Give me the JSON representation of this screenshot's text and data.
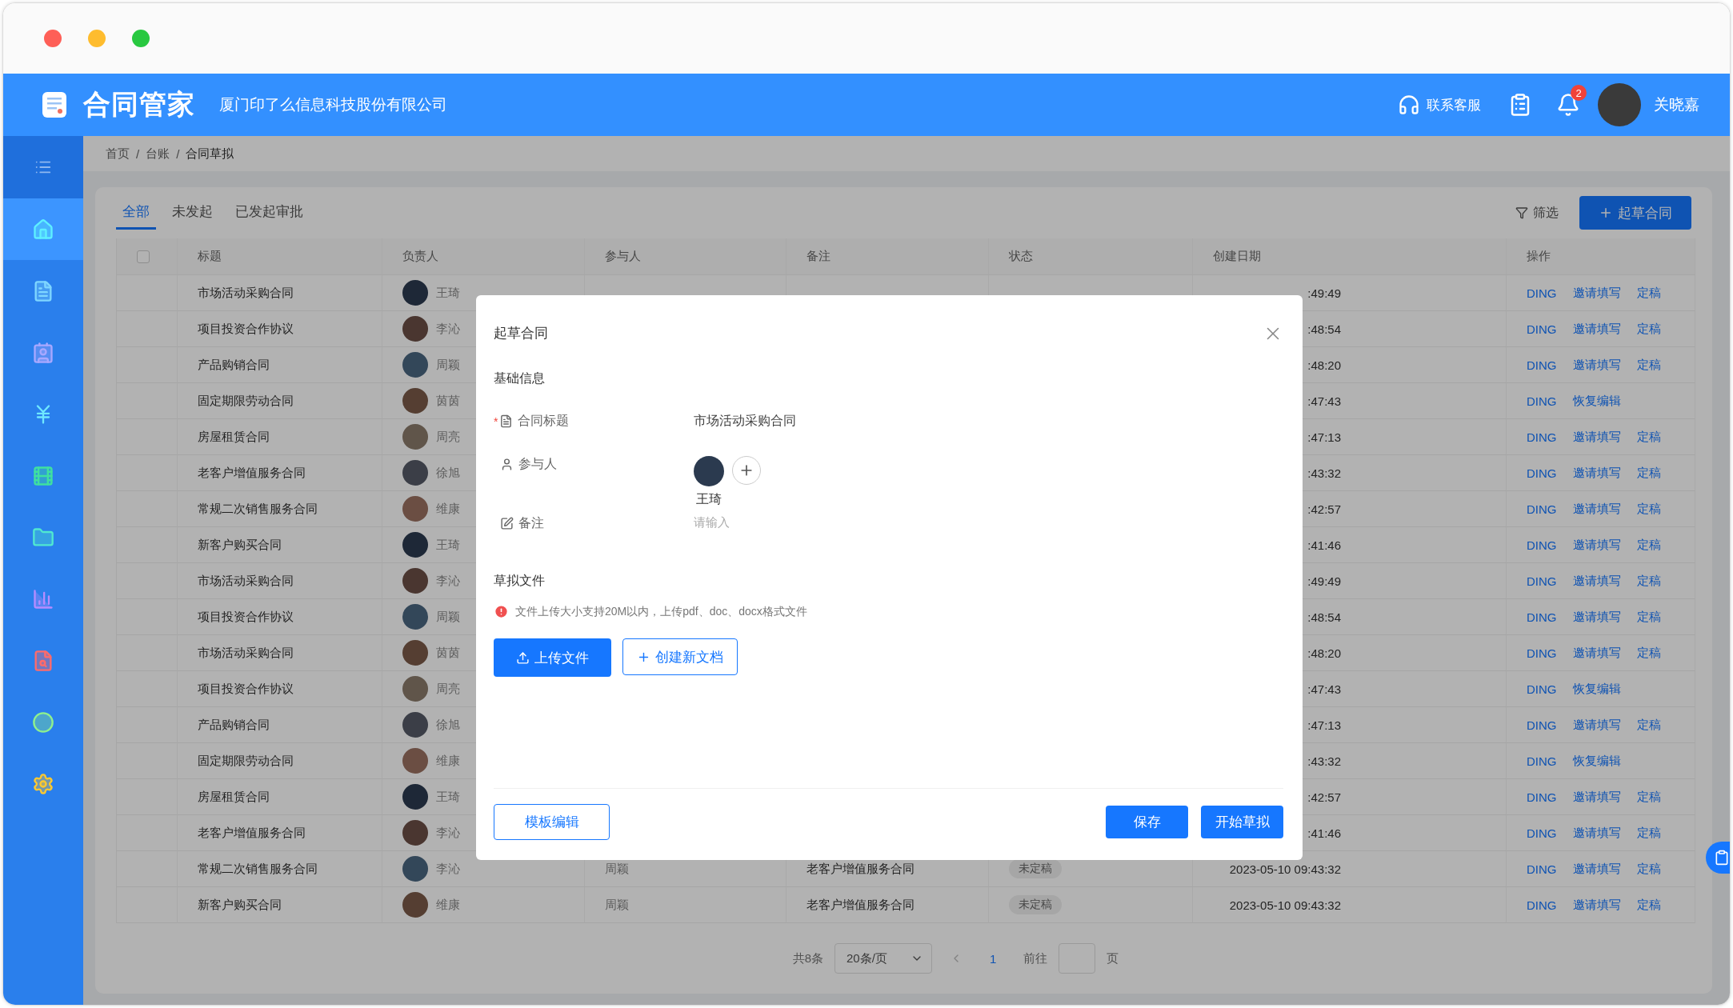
{
  "header": {
    "logo_text": "合同管家",
    "company": "厦门印了么信息科技股份有限公司",
    "support": "联系客服",
    "notification_count": "2",
    "user_name": "关晓嘉"
  },
  "sidebar": {
    "items": [
      {
        "selected": true
      },
      {
        "selected": false
      },
      {
        "selected": false
      },
      {
        "selected": false
      },
      {
        "selected": false
      },
      {
        "selected": false
      },
      {
        "selected": false
      },
      {
        "selected": false
      },
      {
        "selected": false
      },
      {
        "selected": false
      }
    ]
  },
  "breadcrumb": {
    "separator": "/",
    "items": [
      "首页",
      "台账",
      "合同草拟"
    ]
  },
  "tabs": [
    {
      "label": "全部",
      "selected": true
    },
    {
      "label": "未发起",
      "selected": false
    },
    {
      "label": "已发起审批",
      "selected": false
    }
  ],
  "toolbar": {
    "filter": "筛选",
    "create": "起草合同"
  },
  "table": {
    "select_all_checked": false,
    "columns": [
      "标题",
      "负责人",
      "参与人",
      "备注",
      "状态",
      "创建日期",
      "操作"
    ],
    "rows": [
      {
        "title": "市场活动采购合同",
        "owner": "王琦",
        "created": ":49:49",
        "actions": [
          "DING",
          "邀请填写",
          "定稿"
        ]
      },
      {
        "title": "项目投资合作协议",
        "owner": "李沁",
        "created": ":48:54",
        "actions": [
          "DING",
          "邀请填写",
          "定稿"
        ]
      },
      {
        "title": "产品购销合同",
        "owner": "周颖",
        "created": ":48:20",
        "actions": [
          "DING",
          "邀请填写",
          "定稿"
        ]
      },
      {
        "title": "固定期限劳动合同",
        "owner": "茵茵",
        "created": ":47:43",
        "actions": [
          "DING",
          "恢复编辑"
        ]
      },
      {
        "title": "房屋租赁合同",
        "owner": "周亮",
        "created": ":47:13",
        "actions": [
          "DING",
          "邀请填写",
          "定稿"
        ]
      },
      {
        "title": "老客户增值服务合同",
        "owner": "徐旭",
        "created": ":43:32",
        "actions": [
          "DING",
          "邀请填写",
          "定稿"
        ]
      },
      {
        "title": "常规二次销售服务合同",
        "owner": "维康",
        "created": ":42:57",
        "actions": [
          "DING",
          "邀请填写",
          "定稿"
        ]
      },
      {
        "title": "新客户购买合同",
        "owner": "王琦",
        "created": ":41:46",
        "actions": [
          "DING",
          "邀请填写",
          "定稿"
        ]
      },
      {
        "title": "市场活动采购合同",
        "owner": "李沁",
        "created": ":49:49",
        "actions": [
          "DING",
          "邀请填写",
          "定稿"
        ]
      },
      {
        "title": "项目投资合作协议",
        "owner": "周颖",
        "created": ":48:54",
        "actions": [
          "DING",
          "邀请填写",
          "定稿"
        ]
      },
      {
        "title": "市场活动采购合同",
        "owner": "茵茵",
        "created": ":48:20",
        "actions": [
          "DING",
          "邀请填写",
          "定稿"
        ]
      },
      {
        "title": "项目投资合作协议",
        "owner": "周亮",
        "created": ":47:43",
        "actions": [
          "DING",
          "恢复编辑"
        ]
      },
      {
        "title": "产品购销合同",
        "owner": "徐旭",
        "created": ":47:13",
        "actions": [
          "DING",
          "邀请填写",
          "定稿"
        ]
      },
      {
        "title": "固定期限劳动合同",
        "owner": "维康",
        "created": ":43:32",
        "actions": [
          "DING",
          "恢复编辑"
        ]
      },
      {
        "title": "房屋租赁合同",
        "owner": "王琦",
        "created": ":42:57",
        "actions": [
          "DING",
          "邀请填写",
          "定稿"
        ]
      },
      {
        "title": "老客户增值服务合同",
        "owner": "李沁",
        "created": ":41:46",
        "actions": [
          "DING",
          "邀请填写",
          "定稿"
        ]
      },
      {
        "title": "常规二次销售服务合同",
        "owner": "李沁",
        "participants": "周颖",
        "note": "老客户增值服务合同",
        "status": "未定稿",
        "created": "2023-05-10 09:43:32",
        "actions": [
          "DING",
          "邀请填写",
          "定稿"
        ]
      },
      {
        "title": "新客户购买合同",
        "owner": "维康",
        "participants": "周颖",
        "note": "老客户增值服务合同",
        "status": "未定稿",
        "created": "2023-05-10 09:43:32",
        "actions": [
          "DING",
          "邀请填写",
          "定稿"
        ]
      }
    ]
  },
  "pagination": {
    "total": "共8条",
    "page_size": "20条/页",
    "current_page": "1",
    "goto_label": "前往",
    "page_unit": "页"
  },
  "dialog": {
    "title": "起草合同",
    "section_basic": "基础信息",
    "fields": [
      {
        "kind": "text",
        "label": "合同标题",
        "required_mark": "*",
        "value": "市场活动采购合同"
      },
      {
        "kind": "people",
        "label": "参与人",
        "people": [
          "王琦"
        ]
      },
      {
        "kind": "input",
        "label": "备注",
        "placeholder": "请输入"
      }
    ],
    "section_files": "草拟文件",
    "notice": "文件上传大小支持20M以内，上传pdf、doc、docx格式文件",
    "upload": "上传文件",
    "create_doc": "创建新文档",
    "template": "模板编辑",
    "save": "保存",
    "start": "开始草拟"
  }
}
